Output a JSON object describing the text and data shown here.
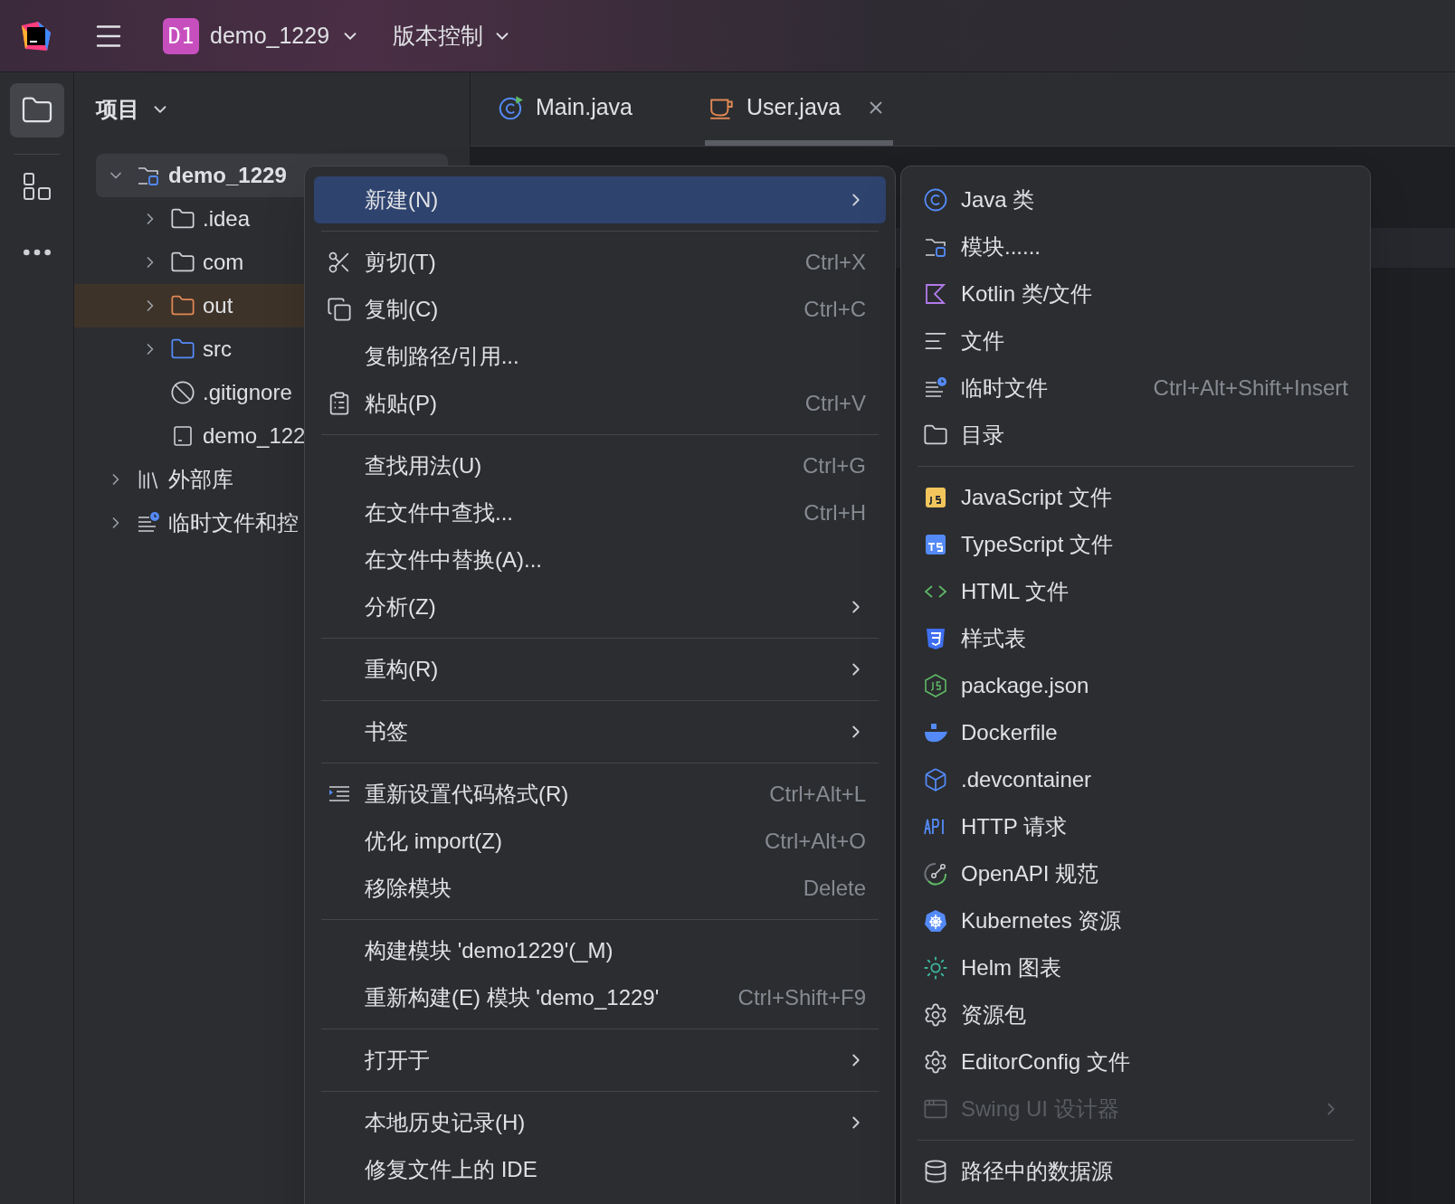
{
  "title_bar": {
    "project_badge": "D1",
    "project_name": "demo_1229",
    "vcs_label": "版本控制"
  },
  "project_panel": {
    "title": "项目",
    "tree": [
      {
        "label": "demo_1229",
        "kind": "module",
        "expanded": true,
        "selected": true,
        "children": [
          {
            "label": ".idea",
            "kind": "folder",
            "expanded": false,
            "selected": false
          },
          {
            "label": "com",
            "kind": "folder",
            "expanded": false,
            "selected": false
          },
          {
            "label": "out",
            "kind": "excluded_folder",
            "expanded": false,
            "selected": false
          },
          {
            "label": "src",
            "kind": "source_folder",
            "expanded": false,
            "selected": false
          },
          {
            "label": ".gitignore",
            "kind": "ignore_file",
            "selected": false
          },
          {
            "label": "demo_122",
            "kind": "module_file",
            "selected": false
          }
        ]
      },
      {
        "label": "外部库",
        "kind": "library",
        "expanded": false,
        "selected": false
      },
      {
        "label": "临时文件和控",
        "kind": "scratches",
        "expanded": false,
        "selected": false
      }
    ]
  },
  "editor_tabs": [
    {
      "label": "Main.java",
      "kind": "main_class",
      "selected": false,
      "closable": false
    },
    {
      "label": "User.java",
      "kind": "java_class",
      "selected": true,
      "closable": true
    }
  ],
  "context_menu": {
    "groups": [
      {
        "items": [
          {
            "label": "新建(N)",
            "kind": "plain",
            "submenu": true,
            "selected": true
          }
        ]
      },
      {
        "items": [
          {
            "label": "剪切(T)",
            "kind": "cut",
            "shortcut": "Ctrl+X",
            "submenu": false,
            "selected": false
          },
          {
            "label": "复制(C)",
            "kind": "copy",
            "shortcut": "Ctrl+C",
            "submenu": false,
            "selected": false
          },
          {
            "label": "复制路径/引用...",
            "kind": "plain",
            "submenu": false,
            "selected": false
          },
          {
            "label": "粘贴(P)",
            "kind": "paste",
            "shortcut": "Ctrl+V",
            "submenu": false,
            "selected": false
          }
        ]
      },
      {
        "items": [
          {
            "label": "查找用法(U)",
            "kind": "plain",
            "shortcut": "Ctrl+G",
            "submenu": false,
            "selected": false
          },
          {
            "label": "在文件中查找...",
            "kind": "plain",
            "shortcut": "Ctrl+H",
            "submenu": false,
            "selected": false
          },
          {
            "label": "在文件中替换(A)...",
            "kind": "plain",
            "submenu": false,
            "selected": false
          },
          {
            "label": "分析(Z)",
            "kind": "plain",
            "submenu": true,
            "selected": false
          }
        ]
      },
      {
        "items": [
          {
            "label": "重构(R)",
            "kind": "plain",
            "submenu": true,
            "selected": false
          }
        ]
      },
      {
        "items": [
          {
            "label": "书签",
            "kind": "plain",
            "submenu": true,
            "selected": false
          }
        ]
      },
      {
        "items": [
          {
            "label": "重新设置代码格式(R)",
            "kind": "reformat",
            "shortcut": "Ctrl+Alt+L",
            "submenu": false,
            "selected": false
          },
          {
            "label": "优化 import(Z)",
            "kind": "plain",
            "shortcut": "Ctrl+Alt+O",
            "submenu": false,
            "selected": false
          },
          {
            "label": "移除模块",
            "kind": "plain",
            "shortcut": "Delete",
            "submenu": false,
            "selected": false
          }
        ]
      },
      {
        "items": [
          {
            "label": "构建模块 'demo1229'(_M)",
            "kind": "plain",
            "submenu": false,
            "selected": false
          },
          {
            "label": "重新构建(E) 模块 'demo_1229'",
            "kind": "plain",
            "shortcut": "Ctrl+Shift+F9",
            "submenu": false,
            "selected": false
          }
        ]
      },
      {
        "items": [
          {
            "label": "打开于",
            "kind": "plain",
            "submenu": true,
            "selected": false
          }
        ]
      },
      {
        "items": [
          {
            "label": "本地历史记录(H)",
            "kind": "plain",
            "submenu": true,
            "selected": false
          },
          {
            "label": "修复文件上的 IDE",
            "kind": "plain",
            "submenu": false,
            "selected": false
          }
        ]
      }
    ]
  },
  "new_submenu": {
    "groups": [
      {
        "items": [
          {
            "label": "Java 类",
            "kind": "java_class",
            "disabled": false,
            "submenu": false
          },
          {
            "label": "模块......",
            "kind": "module",
            "disabled": false,
            "submenu": false
          },
          {
            "label": "Kotlin 类/文件",
            "kind": "kotlin",
            "disabled": false,
            "submenu": false
          },
          {
            "label": "文件",
            "kind": "file",
            "disabled": false,
            "submenu": false
          },
          {
            "label": "临时文件",
            "kind": "scratch",
            "shortcut": "Ctrl+Alt+Shift+Insert",
            "disabled": false,
            "submenu": false
          },
          {
            "label": "目录",
            "kind": "directory",
            "disabled": false,
            "submenu": false
          }
        ]
      },
      {
        "items": [
          {
            "label": "JavaScript 文件",
            "kind": "javascript",
            "disabled": false,
            "submenu": false
          },
          {
            "label": "TypeScript 文件",
            "kind": "typescript",
            "disabled": false,
            "submenu": false
          },
          {
            "label": "HTML 文件",
            "kind": "html",
            "disabled": false,
            "submenu": false
          },
          {
            "label": "样式表",
            "kind": "stylesheet",
            "disabled": false,
            "submenu": false
          },
          {
            "label": "package.json",
            "kind": "package_json",
            "disabled": false,
            "submenu": false
          },
          {
            "label": "Dockerfile",
            "kind": "dockerfile",
            "disabled": false,
            "submenu": false
          },
          {
            "label": ".devcontainer",
            "kind": "devcontainer",
            "disabled": false,
            "submenu": false
          },
          {
            "label": "HTTP 请求",
            "kind": "http",
            "disabled": false,
            "submenu": false
          },
          {
            "label": "OpenAPI 规范",
            "kind": "openapi",
            "disabled": false,
            "submenu": false
          },
          {
            "label": "Kubernetes 资源",
            "kind": "kubernetes",
            "disabled": false,
            "submenu": false
          },
          {
            "label": "Helm 图表",
            "kind": "helm",
            "disabled": false,
            "submenu": false
          },
          {
            "label": "资源包",
            "kind": "resource_bundle",
            "disabled": false,
            "submenu": false
          },
          {
            "label": "EditorConfig 文件",
            "kind": "editorconfig",
            "disabled": false,
            "submenu": false
          },
          {
            "label": "Swing UI 设计器",
            "kind": "swing",
            "disabled": true,
            "submenu": true
          }
        ]
      },
      {
        "items": [
          {
            "label": "路径中的数据源",
            "kind": "datasource",
            "disabled": false,
            "submenu": false
          }
        ]
      }
    ]
  }
}
